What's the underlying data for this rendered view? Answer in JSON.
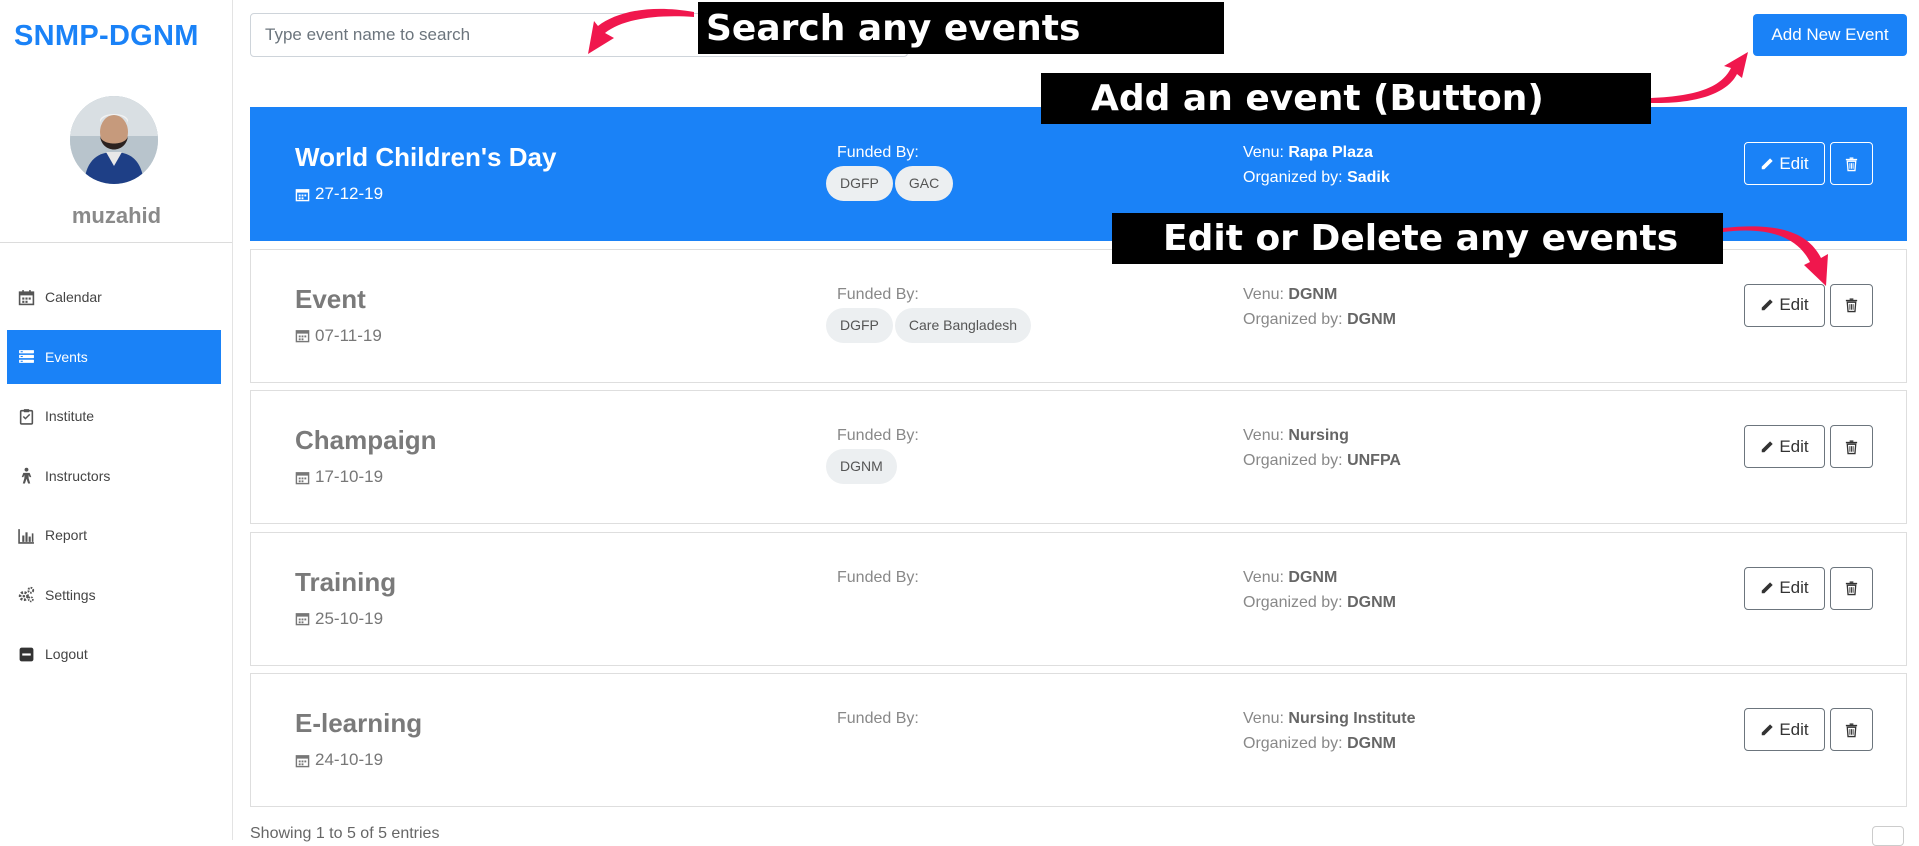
{
  "sidebar": {
    "brand": "SNMP-DGNM",
    "username": "muzahid",
    "items": [
      {
        "label": "Calendar",
        "icon": "calendar-icon",
        "active": false
      },
      {
        "label": "Events",
        "icon": "events-icon",
        "active": true
      },
      {
        "label": "Institute",
        "icon": "clipboard-icon",
        "active": false
      },
      {
        "label": "Instructors",
        "icon": "person-icon",
        "active": false
      },
      {
        "label": "Report",
        "icon": "bar-chart-icon",
        "active": false
      },
      {
        "label": "Settings",
        "icon": "gears-icon",
        "active": false
      },
      {
        "label": "Logout",
        "icon": "minus-square-icon",
        "active": false
      }
    ]
  },
  "search": {
    "placeholder": "Type event name to search",
    "value": ""
  },
  "toolbar": {
    "add_label": "Add New Event"
  },
  "labels": {
    "funded_by": "Funded By:",
    "venue_prefix": "Venu:",
    "organized_prefix": "Organized by:",
    "edit": "Edit"
  },
  "events": [
    {
      "title": "World Children's Day",
      "date": "27-12-19",
      "funders": [
        "DGFP",
        "GAC"
      ],
      "venue": "Rapa Plaza",
      "organizer": "Sadik",
      "highlighted": true
    },
    {
      "title": "Event",
      "date": "07-11-19",
      "funders": [
        "DGFP",
        "Care Bangladesh"
      ],
      "venue": "DGNM",
      "organizer": "DGNM",
      "highlighted": false
    },
    {
      "title": "Champaign",
      "date": "17-10-19",
      "funders": [
        "DGNM"
      ],
      "venue": "Nursing",
      "organizer": "UNFPA",
      "highlighted": false
    },
    {
      "title": "Training",
      "date": "25-10-19",
      "funders": [],
      "venue": "DGNM",
      "organizer": "DGNM",
      "highlighted": false
    },
    {
      "title": "E-learning",
      "date": "24-10-19",
      "funders": [],
      "venue": "Nursing Institute",
      "organizer": "DGNM",
      "highlighted": false
    }
  ],
  "footer": {
    "info": "Showing 1 to 5 of 5 entries"
  },
  "annotations": {
    "search": "Search any events",
    "add": "Add an event (Button)",
    "edit": "Edit or Delete any events"
  },
  "colors": {
    "primary": "#1a82f7",
    "arrow": "#f0174d",
    "annotation_bg": "#000000"
  }
}
